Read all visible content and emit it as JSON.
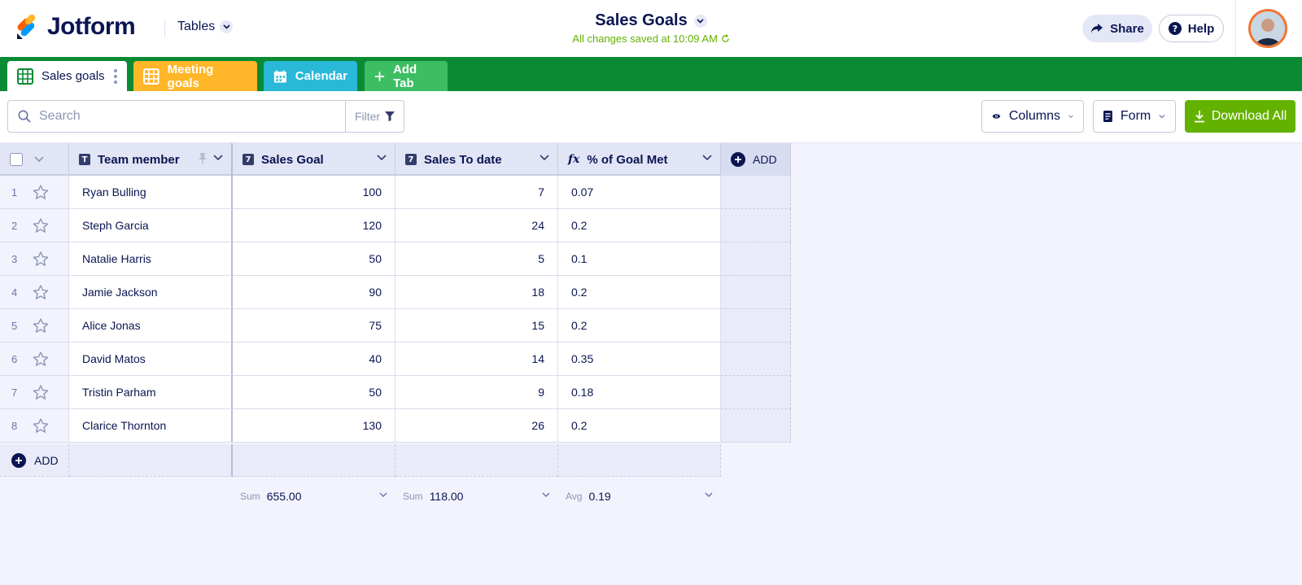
{
  "header": {
    "brand": "Jotform",
    "tables_menu": "Tables",
    "title": "Sales Goals",
    "save_status": "All changes saved at 10:09 AM",
    "share_label": "Share",
    "help_label": "Help"
  },
  "tabs": [
    {
      "label": "Sales goals",
      "icon": "grid-icon"
    },
    {
      "label": "Meeting goals",
      "icon": "grid-icon"
    },
    {
      "label": "Calendar",
      "icon": "calendar-icon"
    },
    {
      "label": "Add Tab",
      "icon": "plus-icon"
    }
  ],
  "toolbar": {
    "search_placeholder": "Search",
    "filter_label": "Filter",
    "columns_label": "Columns",
    "form_label": "Form",
    "download_label": "Download All"
  },
  "columns": [
    {
      "label": "Team member",
      "type": "T"
    },
    {
      "label": "Sales Goal",
      "type": "7"
    },
    {
      "label": "Sales To date",
      "type": "7"
    },
    {
      "label": "% of Goal Met",
      "type": "fx"
    }
  ],
  "add_column_label": "ADD",
  "add_row_label": "ADD",
  "rows": [
    {
      "n": "1",
      "member": "Ryan Bulling",
      "goal": "100",
      "to_date": "7",
      "pct": "0.07"
    },
    {
      "n": "2",
      "member": "Steph Garcia",
      "goal": "120",
      "to_date": "24",
      "pct": "0.2"
    },
    {
      "n": "3",
      "member": "Natalie Harris",
      "goal": "50",
      "to_date": "5",
      "pct": "0.1"
    },
    {
      "n": "4",
      "member": "Jamie Jackson",
      "goal": "90",
      "to_date": "18",
      "pct": "0.2"
    },
    {
      "n": "5",
      "member": "Alice Jonas",
      "goal": "75",
      "to_date": "15",
      "pct": "0.2"
    },
    {
      "n": "6",
      "member": "David Matos",
      "goal": "40",
      "to_date": "14",
      "pct": "0.35"
    },
    {
      "n": "7",
      "member": "Tristin Parham",
      "goal": "50",
      "to_date": "9",
      "pct": "0.18"
    },
    {
      "n": "8",
      "member": "Clarice Thornton",
      "goal": "130",
      "to_date": "26",
      "pct": "0.2"
    }
  ],
  "aggregates": [
    {
      "label": "Sum",
      "value": "655.00"
    },
    {
      "label": "Sum",
      "value": "118.00"
    },
    {
      "label": "Avg",
      "value": "0.19"
    }
  ],
  "colors": {
    "brand_green": "#0b8a34",
    "download_green": "#64b200",
    "meeting_tab": "#ffb629",
    "calendar_tab": "#29b8d8",
    "add_tab": "#3dbe63",
    "navy": "#0a1551"
  }
}
